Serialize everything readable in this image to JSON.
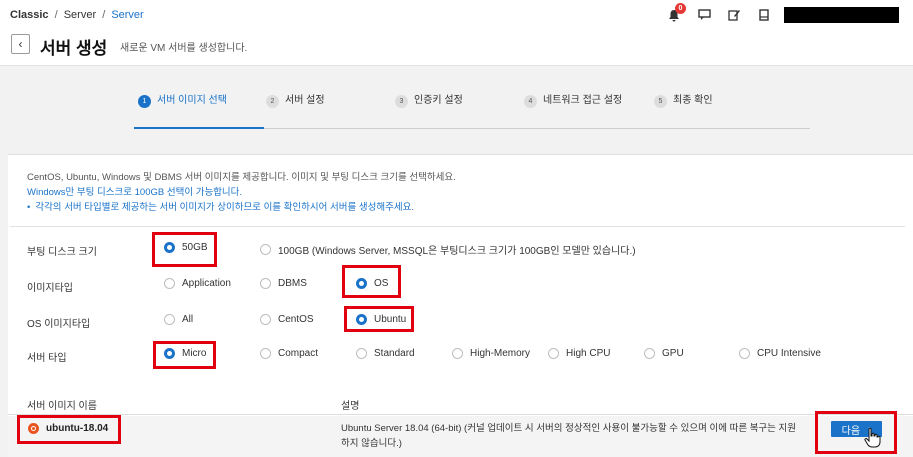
{
  "breadcrumb": {
    "root": "Classic",
    "sep1": "/",
    "mid": "Server",
    "sep2": "/",
    "current": "Server"
  },
  "header": {
    "title": "서버 생성",
    "subtitle": "새로운 VM 서버를 생성합니다.",
    "notification_count": "0",
    "icons": [
      "bell-icon",
      "chat-icon",
      "edit-icon",
      "book-icon"
    ]
  },
  "steps": [
    {
      "num": "1",
      "label": "서버 이미지 선택",
      "active": true
    },
    {
      "num": "2",
      "label": "서버 설정",
      "active": false
    },
    {
      "num": "3",
      "label": "인증키 설정",
      "active": false
    },
    {
      "num": "4",
      "label": "네트워크 접근 설정",
      "active": false
    },
    {
      "num": "5",
      "label": "최종 확인",
      "active": false
    }
  ],
  "info": {
    "line1": "CentOS, Ubuntu, Windows 및 DBMS 서버 이미지를 제공합니다. 이미지 및 부팅 디스크 크기를 선택하세요.",
    "line2": "Windows만 부팅 디스크로 100GB 선택이 가능합니다.",
    "line3": "각각의 서버 타입별로 제공하는 서버 이미지가 상이하므로 이를 확인하시어 서버를 생성해주세요."
  },
  "form": {
    "boot_disk": {
      "label": "부팅 디스크 크기",
      "options": [
        "50GB",
        "100GB (Windows Server, MSSQL은 부팅디스크 크기가 100GB인 모델만 있습니다.)"
      ],
      "selected": "50GB"
    },
    "image_type": {
      "label": "이미지타입",
      "options": [
        "Application",
        "DBMS",
        "OS"
      ],
      "selected": "OS"
    },
    "os_image_type": {
      "label": "OS 이미지타입",
      "options": [
        "All",
        "CentOS",
        "Ubuntu"
      ],
      "selected": "Ubuntu"
    },
    "server_type": {
      "label": "서버 타입",
      "options": [
        "Micro",
        "Compact",
        "Standard",
        "High-Memory",
        "High CPU",
        "GPU",
        "CPU Intensive"
      ],
      "selected": "Micro"
    }
  },
  "table": {
    "col_name": "서버 이미지 이름",
    "col_desc": "설명",
    "rows": [
      {
        "name": "ubuntu-18.04",
        "desc": "Ubuntu Server 18.04 (64-bit) (커널 업데이트 시 서버의 정상적인 사용이 불가능할 수 있으며 이에 따른 복구는 지원하지 않습니다.)",
        "action": "다음"
      }
    ]
  },
  "colors": {
    "accent": "#1a73c9",
    "highlight": "#e10010"
  }
}
